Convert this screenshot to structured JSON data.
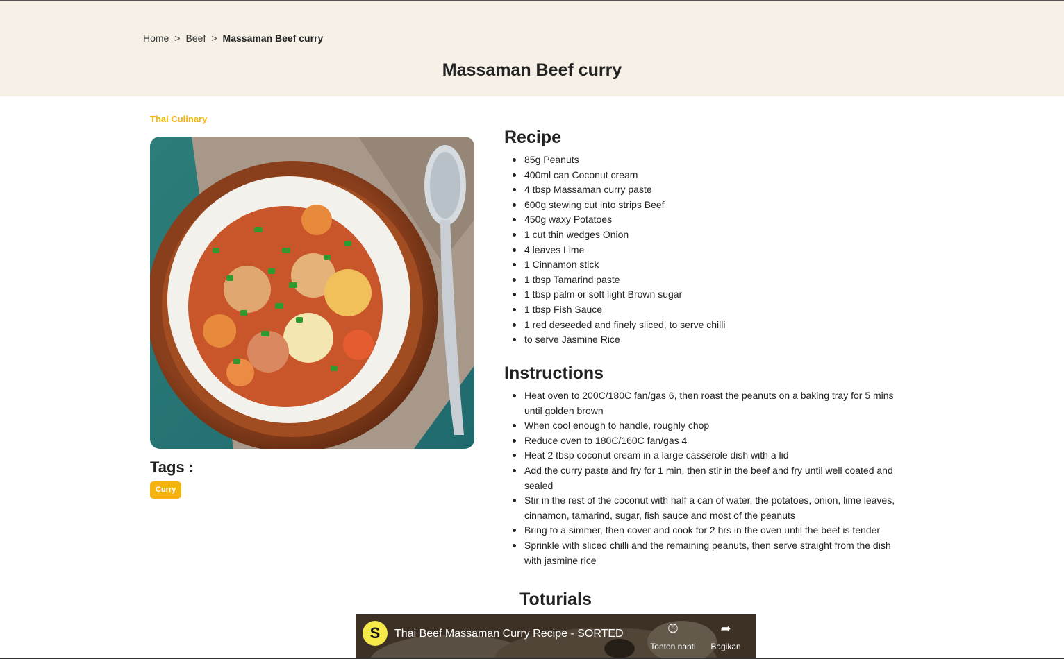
{
  "breadcrumb": {
    "home": "Home",
    "category": "Beef",
    "current": "Massaman Beef curry",
    "separator": ">"
  },
  "page": {
    "title": "Massaman Beef curry",
    "category_label": "Thai Culinary"
  },
  "tags": {
    "title": "Tags :",
    "items": [
      "Curry"
    ]
  },
  "recipe": {
    "title": "Recipe",
    "ingredients": [
      "85g Peanuts",
      "400ml can Coconut cream",
      "4 tbsp Massaman curry paste",
      "600g stewing cut into strips Beef",
      "450g waxy Potatoes",
      "1 cut thin wedges Onion",
      "4 leaves Lime",
      "1 Cinnamon stick",
      "1 tbsp Tamarind paste",
      "1 tbsp palm or soft light Brown sugar",
      "1 tbsp Fish Sauce",
      "1 red deseeded and finely sliced, to serve chilli",
      "to serve Jasmine Rice"
    ]
  },
  "instructions": {
    "title": "Instructions",
    "steps": [
      "Heat oven to 200C/180C fan/gas 6, then roast the peanuts on a baking tray for 5 mins until golden brown",
      "When cool enough to handle, roughly chop",
      "Reduce oven to 180C/160C fan/gas 4",
      "Heat 2 tbsp coconut cream in a large casserole dish with a lid",
      "Add the curry paste and fry for 1 min, then stir in the beef and fry until well coated and sealed",
      "Stir in the rest of the coconut with half a can of water, the potatoes, onion, lime leaves, cinnamon, tamarind, sugar, fish sauce and most of the peanuts",
      "Bring to a simmer, then cover and cook for 2 hrs in the oven until the beef is tender",
      "Sprinkle with sliced chilli and the remaining peanuts, then serve straight from the dish with jasmine rice"
    ]
  },
  "tutorials": {
    "title": "Toturials",
    "video": {
      "title": "Thai Beef Massaman Curry Recipe - SORTED",
      "channel_initial": "S",
      "watch_later": "Tonton nanti",
      "share": "Bagikan",
      "watch_later_icon": "clock-icon",
      "share_icon": "share-arrow-icon"
    }
  },
  "colors": {
    "accent": "#f5b30f",
    "hero_bg": "#f6f0e6",
    "text": "#222222"
  }
}
